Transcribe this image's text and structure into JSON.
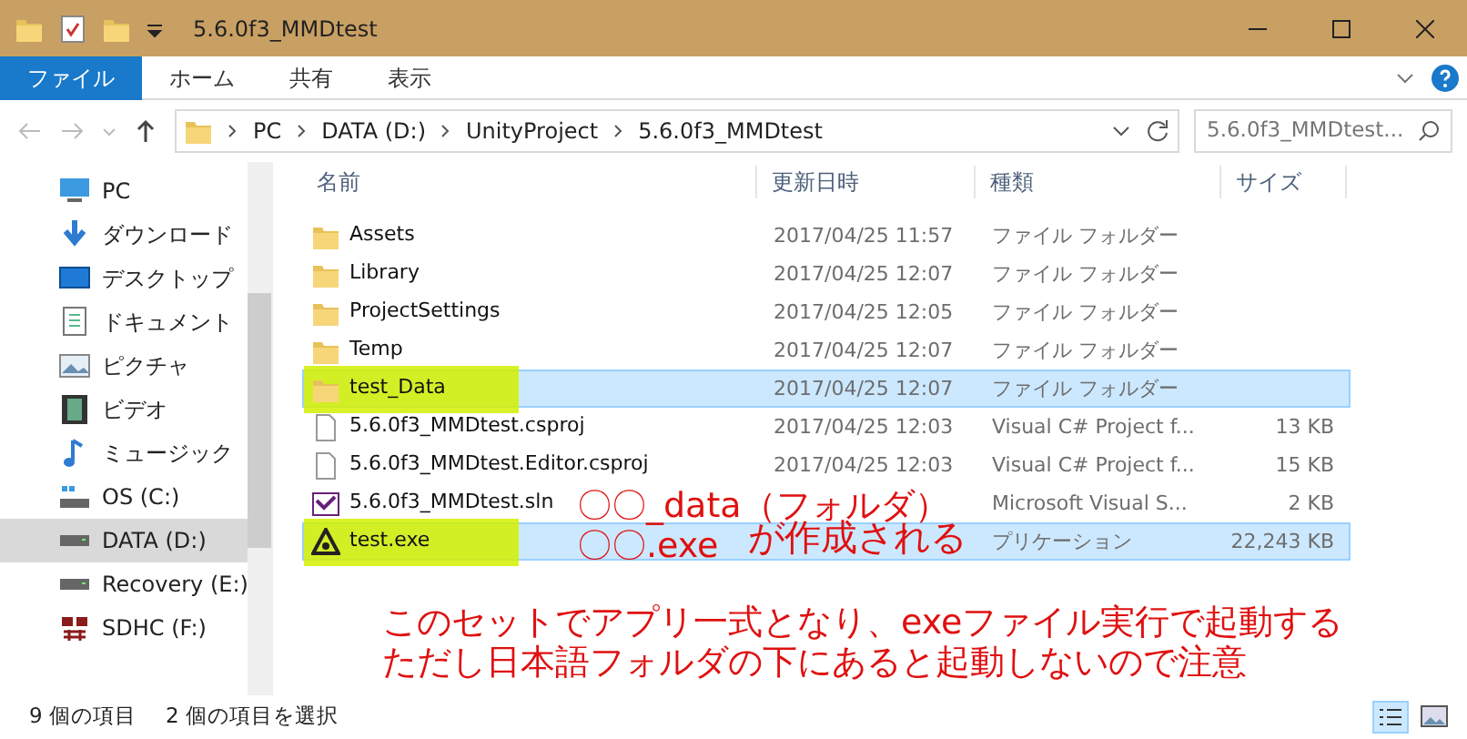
{
  "window": {
    "title": "5.6.0f3_MMDtest"
  },
  "ribbon_tabs": [
    {
      "label": "ファイル",
      "selected": true
    },
    {
      "label": "ホーム",
      "selected": false
    },
    {
      "label": "共有",
      "selected": false
    },
    {
      "label": "表示",
      "selected": false
    }
  ],
  "address": {
    "segments": [
      "PC",
      "DATA (D:)",
      "UnityProject",
      "5.6.0f3_MMDtest"
    ]
  },
  "search": {
    "placeholder": "5.6.0f3_MMDtest..."
  },
  "sidebar": {
    "items": [
      {
        "label": "PC",
        "kind": "pc",
        "selected": false
      },
      {
        "label": "ダウンロード",
        "kind": "download",
        "selected": false
      },
      {
        "label": "デスクトップ",
        "kind": "desktop",
        "selected": false
      },
      {
        "label": "ドキュメント",
        "kind": "document",
        "selected": false
      },
      {
        "label": "ピクチャ",
        "kind": "picture",
        "selected": false
      },
      {
        "label": "ビデオ",
        "kind": "video",
        "selected": false
      },
      {
        "label": "ミュージック",
        "kind": "music",
        "selected": false
      },
      {
        "label": "OS (C:)",
        "kind": "osdrive",
        "selected": false
      },
      {
        "label": "DATA (D:)",
        "kind": "drive",
        "selected": true
      },
      {
        "label": "Recovery (E:)",
        "kind": "drive",
        "selected": false
      },
      {
        "label": "SDHC (F:)",
        "kind": "sd",
        "selected": false
      }
    ]
  },
  "table": {
    "columns": [
      "名前",
      "更新日時",
      "種類",
      "サイズ"
    ],
    "rows": [
      {
        "name": "Assets",
        "kind": "folder",
        "date": "2017/04/25 11:57",
        "type": "ファイル フォルダー",
        "size": "",
        "selected": false,
        "highlighted": false
      },
      {
        "name": "Library",
        "kind": "folder",
        "date": "2017/04/25 12:07",
        "type": "ファイル フォルダー",
        "size": "",
        "selected": false,
        "highlighted": false
      },
      {
        "name": "ProjectSettings",
        "kind": "folder",
        "date": "2017/04/25 12:05",
        "type": "ファイル フォルダー",
        "size": "",
        "selected": false,
        "highlighted": false
      },
      {
        "name": "Temp",
        "kind": "folder",
        "date": "2017/04/25 12:07",
        "type": "ファイル フォルダー",
        "size": "",
        "selected": false,
        "highlighted": false
      },
      {
        "name": "test_Data",
        "kind": "folder",
        "date": "2017/04/25 12:07",
        "type": "ファイル フォルダー",
        "size": "",
        "selected": true,
        "highlighted": true
      },
      {
        "name": "5.6.0f3_MMDtest.csproj",
        "kind": "file",
        "date": "2017/04/25 12:03",
        "type": "Visual C# Project f...",
        "size": "13 KB",
        "selected": false,
        "highlighted": false
      },
      {
        "name": "5.6.0f3_MMDtest.Editor.csproj",
        "kind": "file",
        "date": "2017/04/25 12:03",
        "type": "Visual C# Project f...",
        "size": "15 KB",
        "selected": false,
        "highlighted": false
      },
      {
        "name": "5.6.0f3_MMDtest.sln",
        "kind": "sln",
        "date": "",
        "type": "Microsoft Visual S...",
        "size": "2 KB",
        "selected": false,
        "highlighted": false
      },
      {
        "name": "test.exe",
        "kind": "unity",
        "date": "",
        "type": "プリケーション",
        "size": "22,243 KB",
        "selected": true,
        "highlighted": true
      }
    ]
  },
  "annotations": [
    "〇〇_data（フォルダ）",
    "〇〇.exe",
    "が作成される",
    "このセットでアプリ一式となり、exeファイル実行で起動する",
    "ただし日本語フォルダの下にあると起動しないので注意"
  ],
  "status_bar": {
    "count": "9 個の項目",
    "selection": "2 個の項目を選択"
  }
}
